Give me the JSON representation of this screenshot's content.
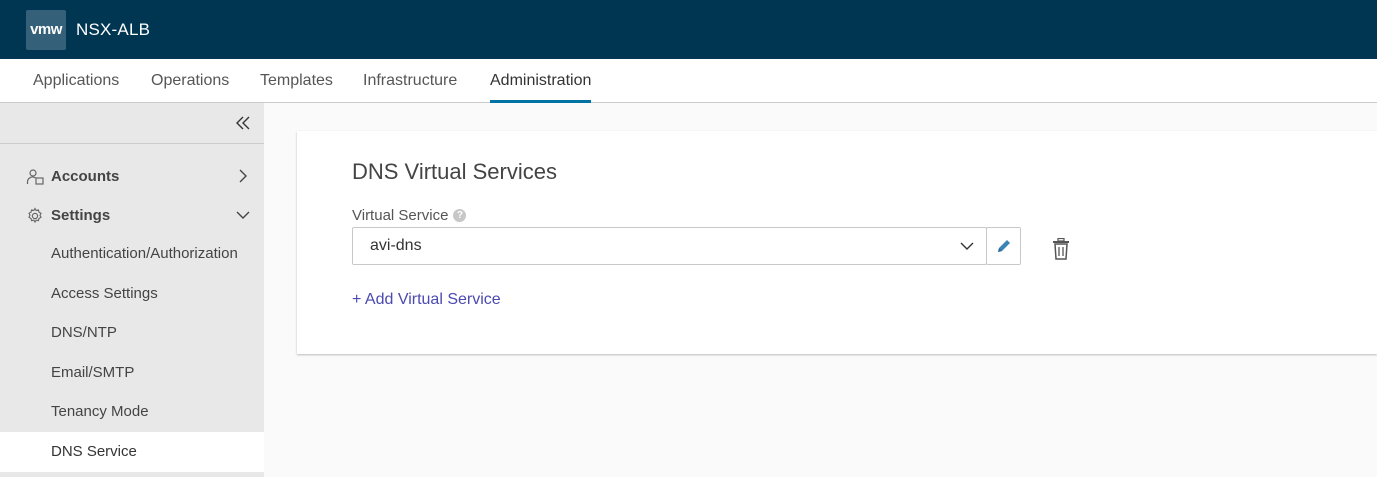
{
  "header": {
    "logo_text": "vmw",
    "app_title": "NSX-ALB",
    "background_color": "#003652"
  },
  "nav": {
    "tabs": [
      {
        "label": "Applications"
      },
      {
        "label": "Operations"
      },
      {
        "label": "Templates"
      },
      {
        "label": "Infrastructure"
      },
      {
        "label": "Administration",
        "active": true
      }
    ],
    "accent_color": "#0072a3"
  },
  "sidebar": {
    "collapse_icon": "double-chevron-left-icon",
    "groups": [
      {
        "label": "Accounts",
        "icon": "user-group-icon",
        "expanded": false
      },
      {
        "label": "Settings",
        "icon": "gear-icon",
        "expanded": true
      }
    ],
    "settings_items": [
      {
        "label": "Authentication/Authorization"
      },
      {
        "label": "Access Settings"
      },
      {
        "label": "DNS/NTP"
      },
      {
        "label": "Email/SMTP"
      },
      {
        "label": "Tenancy Mode"
      },
      {
        "label": "DNS Service",
        "active": true
      }
    ]
  },
  "main": {
    "title": "DNS Virtual Services",
    "field_label": "Virtual Service",
    "help_icon": "?",
    "selected_value": "avi-dns",
    "add_link": "+ Add Virtual Service",
    "link_color": "#4a4ab0"
  }
}
